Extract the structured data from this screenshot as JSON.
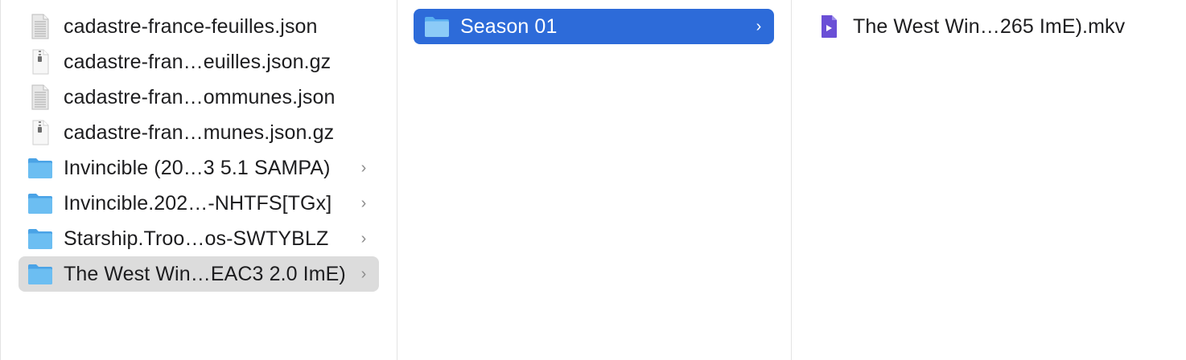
{
  "columns": [
    {
      "items": [
        {
          "label": "cadastre-france-feuilles.json",
          "icon": "json-file-icon",
          "has_chevron": false,
          "selected": false
        },
        {
          "label": "cadastre-fran…euilles.json.gz",
          "icon": "gzip-archive-icon",
          "has_chevron": false,
          "selected": false
        },
        {
          "label": "cadastre-fran…ommunes.json",
          "icon": "json-file-icon",
          "has_chevron": false,
          "selected": false
        },
        {
          "label": "cadastre-fran…munes.json.gz",
          "icon": "gzip-archive-icon",
          "has_chevron": false,
          "selected": false
        },
        {
          "label": "Invincible (20…3 5.1 SAMPA)",
          "icon": "folder-icon",
          "has_chevron": true,
          "selected": false
        },
        {
          "label": "Invincible.202…-NHTFS[TGx]",
          "icon": "folder-icon",
          "has_chevron": true,
          "selected": false
        },
        {
          "label": "Starship.Troo…os-SWTYBLZ",
          "icon": "folder-icon",
          "has_chevron": true,
          "selected": false
        },
        {
          "label": "The West Win…EAC3 2.0 ImE)",
          "icon": "folder-icon",
          "has_chevron": true,
          "selected": "inactive"
        }
      ]
    },
    {
      "items": [
        {
          "label": "Season 01",
          "icon": "folder-icon",
          "has_chevron": true,
          "selected": "active"
        }
      ]
    },
    {
      "items": [
        {
          "label": "The West Win…265 ImE).mkv",
          "icon": "video-file-icon",
          "has_chevron": false,
          "selected": false
        }
      ]
    }
  ],
  "chevron_glyph": "›",
  "colors": {
    "selection_active": "#2d6bd9",
    "selection_inactive": "#dcdcdc",
    "folder_blue": "#5fb4ee",
    "video_purple": "#6a4fd6"
  }
}
